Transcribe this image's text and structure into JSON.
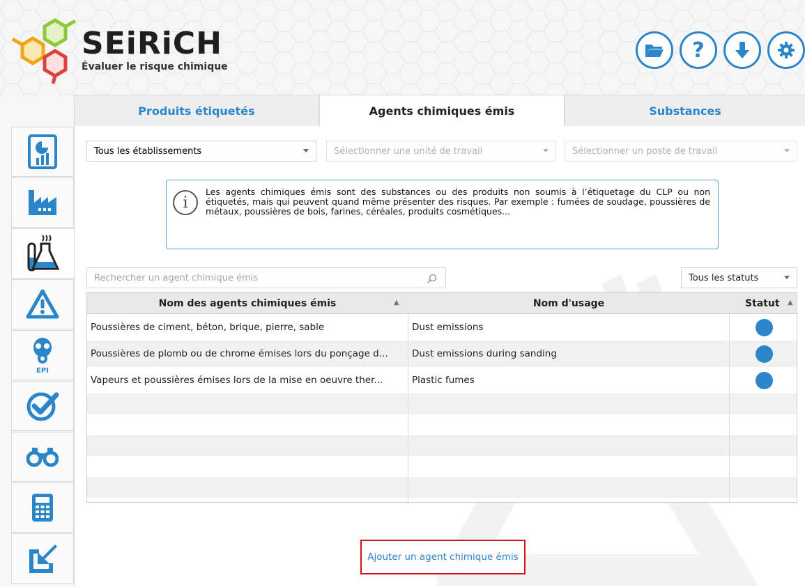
{
  "brand": {
    "name": "SEiRiCH",
    "tagline": "Évaluer le risque chimique"
  },
  "header_buttons": [
    {
      "name": "folder-icon",
      "label": ""
    },
    {
      "name": "help-icon",
      "label": "?"
    },
    {
      "name": "download-icon",
      "label": ""
    },
    {
      "name": "settings-icon",
      "label": ""
    }
  ],
  "tabs": [
    {
      "label": "Produits étiquetés",
      "active": false
    },
    {
      "label": "Agents chimiques émis",
      "active": true
    },
    {
      "label": "Substances",
      "active": false
    }
  ],
  "sidenav": [
    {
      "icon": "report-chart-icon"
    },
    {
      "icon": "factory-icon"
    },
    {
      "icon": "lab-flasks-icon",
      "active": true
    },
    {
      "icon": "warning-icon"
    },
    {
      "icon": "gas-mask-epi-icon",
      "label": "EPI"
    },
    {
      "icon": "check-circle-icon"
    },
    {
      "icon": "binoculars-icon"
    },
    {
      "icon": "calculator-icon"
    },
    {
      "icon": "export-arrow-icon"
    }
  ],
  "filters": {
    "establishment": "Tous les établissements",
    "work_unit_placeholder": "Sélectionner une unité de travail",
    "workstation_placeholder": "Sélectionner un poste de travail"
  },
  "info": {
    "text": "Les agents chimiques émis sont des substances ou des produits non soumis à l’étiquetage du CLP ou non étiquetés, mais qui peuvent quand même présenter des risques. Par exemple : fumées de soudage, poussières de métaux, poussières de bois, farines, céréales, produits cosmétiques..."
  },
  "search": {
    "placeholder": "Rechercher un agent chimique émis"
  },
  "status_filter": "Tous les statuts",
  "table": {
    "columns": [
      "Nom des agents chimiques émis",
      "Nom d'usage",
      "Statut"
    ],
    "rows": [
      {
        "name": "Poussières de ciment, béton, brique, pierre, sable",
        "usage": "Dust emissions",
        "status_color": "#2b85c9"
      },
      {
        "name": "Poussières de plomb ou de chrome émises lors du ponçage d...",
        "usage": "Dust emissions during sanding",
        "status_color": "#2b85c9"
      },
      {
        "name": "Vapeurs et poussières émises lors de la mise en oeuvre ther...",
        "usage": "Plastic fumes",
        "status_color": "#2b85c9"
      }
    ]
  },
  "add_button": "Ajouter un agent chimique émis",
  "colors": {
    "accent": "#2b85c9",
    "highlight_border": "#d31515"
  }
}
